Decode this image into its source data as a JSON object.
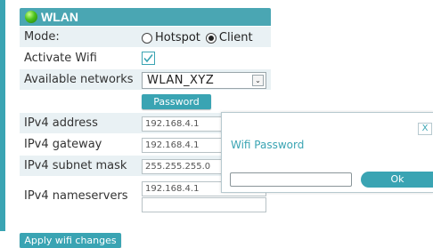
{
  "panel": {
    "title": "WLAN"
  },
  "mode": {
    "label": "Mode:",
    "options": [
      "Hotspot",
      "Client"
    ],
    "selected": "Client"
  },
  "activate_wifi": {
    "label": "Activate Wifi",
    "checked": true
  },
  "available_networks": {
    "label": "Available networks",
    "selected_value": "WLAN_XYZ"
  },
  "password_button": {
    "label": "Password"
  },
  "ipv4": {
    "address": {
      "label": "IPv4 address",
      "value": "192.168.4.1"
    },
    "gateway": {
      "label": "IPv4 gateway",
      "value": "192.168.4.1"
    },
    "subnet_mask": {
      "label": "IPv4 subnet mask",
      "value": "255.255.255.0"
    },
    "nameservers": {
      "label": "IPv4 nameservers",
      "values": [
        "192.168.4.1",
        ""
      ]
    }
  },
  "apply_button": {
    "label": "Apply wifi changes"
  },
  "dialog": {
    "title": "Wifi Password",
    "close_label": "X",
    "password_value": "",
    "ok_label": "Ok"
  },
  "colors": {
    "accent": "#3aa4b3",
    "row_tint": "#e9f1f4",
    "header": "#4aa6b3"
  }
}
